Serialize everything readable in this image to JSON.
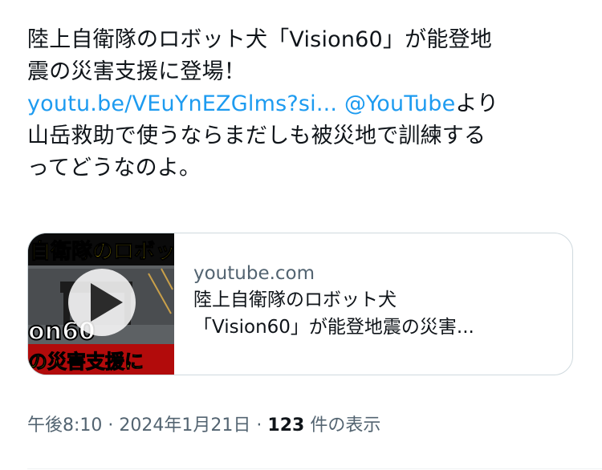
{
  "tweet": {
    "line1": "陸上自衛隊のロボット犬「Vision60」が能登地",
    "line2": "震の災害支援に登場！",
    "link_url": "youtu.be/VEuYnEZGlms?si...",
    "link_mention": "@YouTube",
    "line3_tail": "より",
    "line4": "山岳救助で使うならまだしも被災地で訓練する",
    "line5": "ってどうなのよ。"
  },
  "card": {
    "domain": "youtube.com",
    "title_line1": "陸上自衛隊のロボット犬",
    "title_line2": "「Vision60」が能登地震の災害...",
    "thumbnail": {
      "top_text": "自衛隊のロボッ",
      "mid_text": "on60",
      "bottom_text": "の災害支援に",
      "icon": "play-icon"
    }
  },
  "meta": {
    "time": "午後8:10",
    "date": "2024年1月21日",
    "separator": "·",
    "views_count": "123",
    "views_label": "件の表示"
  },
  "colors": {
    "link": "#1d9bf0",
    "text": "#0f1419",
    "secondary": "#536471",
    "border": "#cfd9de"
  }
}
